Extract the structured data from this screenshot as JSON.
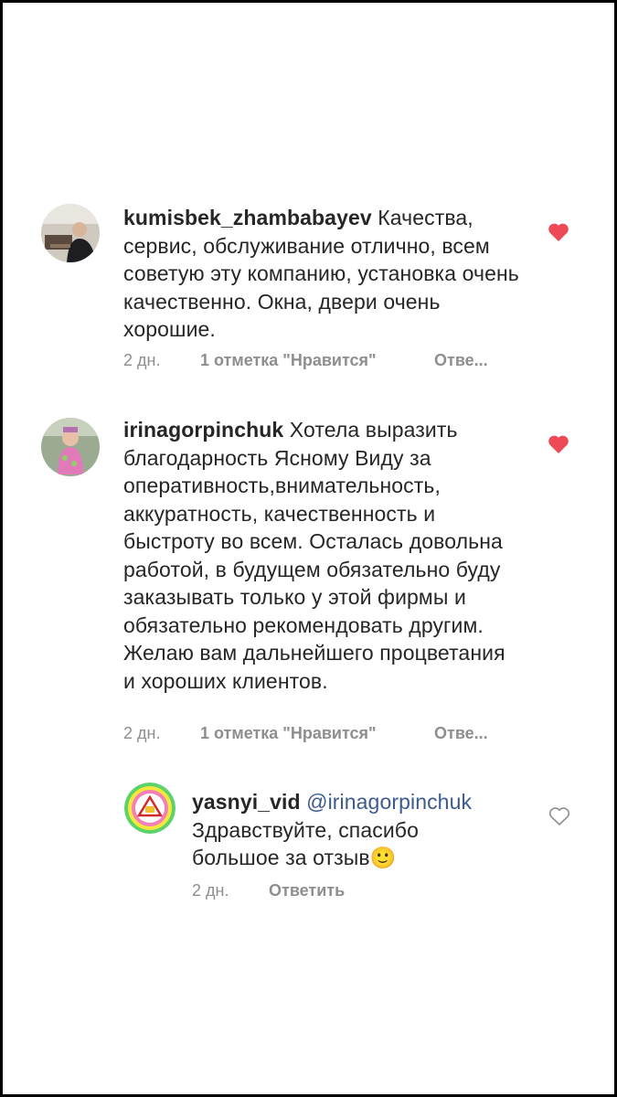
{
  "comments": [
    {
      "username": "kumisbek_zhambabayev",
      "text": "Качества, сервис, обслуживание отлично, всем советую эту компанию, установка очень качественно. Окна, двери очень хорошие.",
      "time": "2 дн.",
      "likes": "1 отметка \"Нравится\"",
      "reply": "Отве...",
      "liked": true,
      "heart_icon": "heart-filled-icon",
      "heart_color": "#ed4956"
    },
    {
      "username": "irinagorpinchuk",
      "text": "Хотела выразить благодарность Ясному Виду за оперативность,внимательность, аккуратность, качественность и быстроту во всем. Осталась довольна работой, в будущем обязательно буду заказывать только у этой фирмы и обязательно рекомендовать другим. Желаю вам дальнейшего процветания и хороших клиентов.",
      "time": "2 дн.",
      "likes": "1 отметка \"Нравится\"",
      "reply": "Отве...",
      "liked": true,
      "heart_icon": "heart-filled-icon",
      "heart_color": "#ed4956"
    }
  ],
  "reply_comment": {
    "username": "yasnyi_vid",
    "mention": "@irinagorpinchuk",
    "text": "Здравствуйте, спасибо большое за отзыв",
    "emoji": "🙂",
    "time": "2 дн.",
    "reply": "Ответить",
    "liked": false,
    "heart_icon": "heart-outline-icon"
  },
  "colors": {
    "text": "#262626",
    "meta": "#8e8e8e",
    "like": "#ed4956",
    "mention": "#3d5a8f"
  }
}
